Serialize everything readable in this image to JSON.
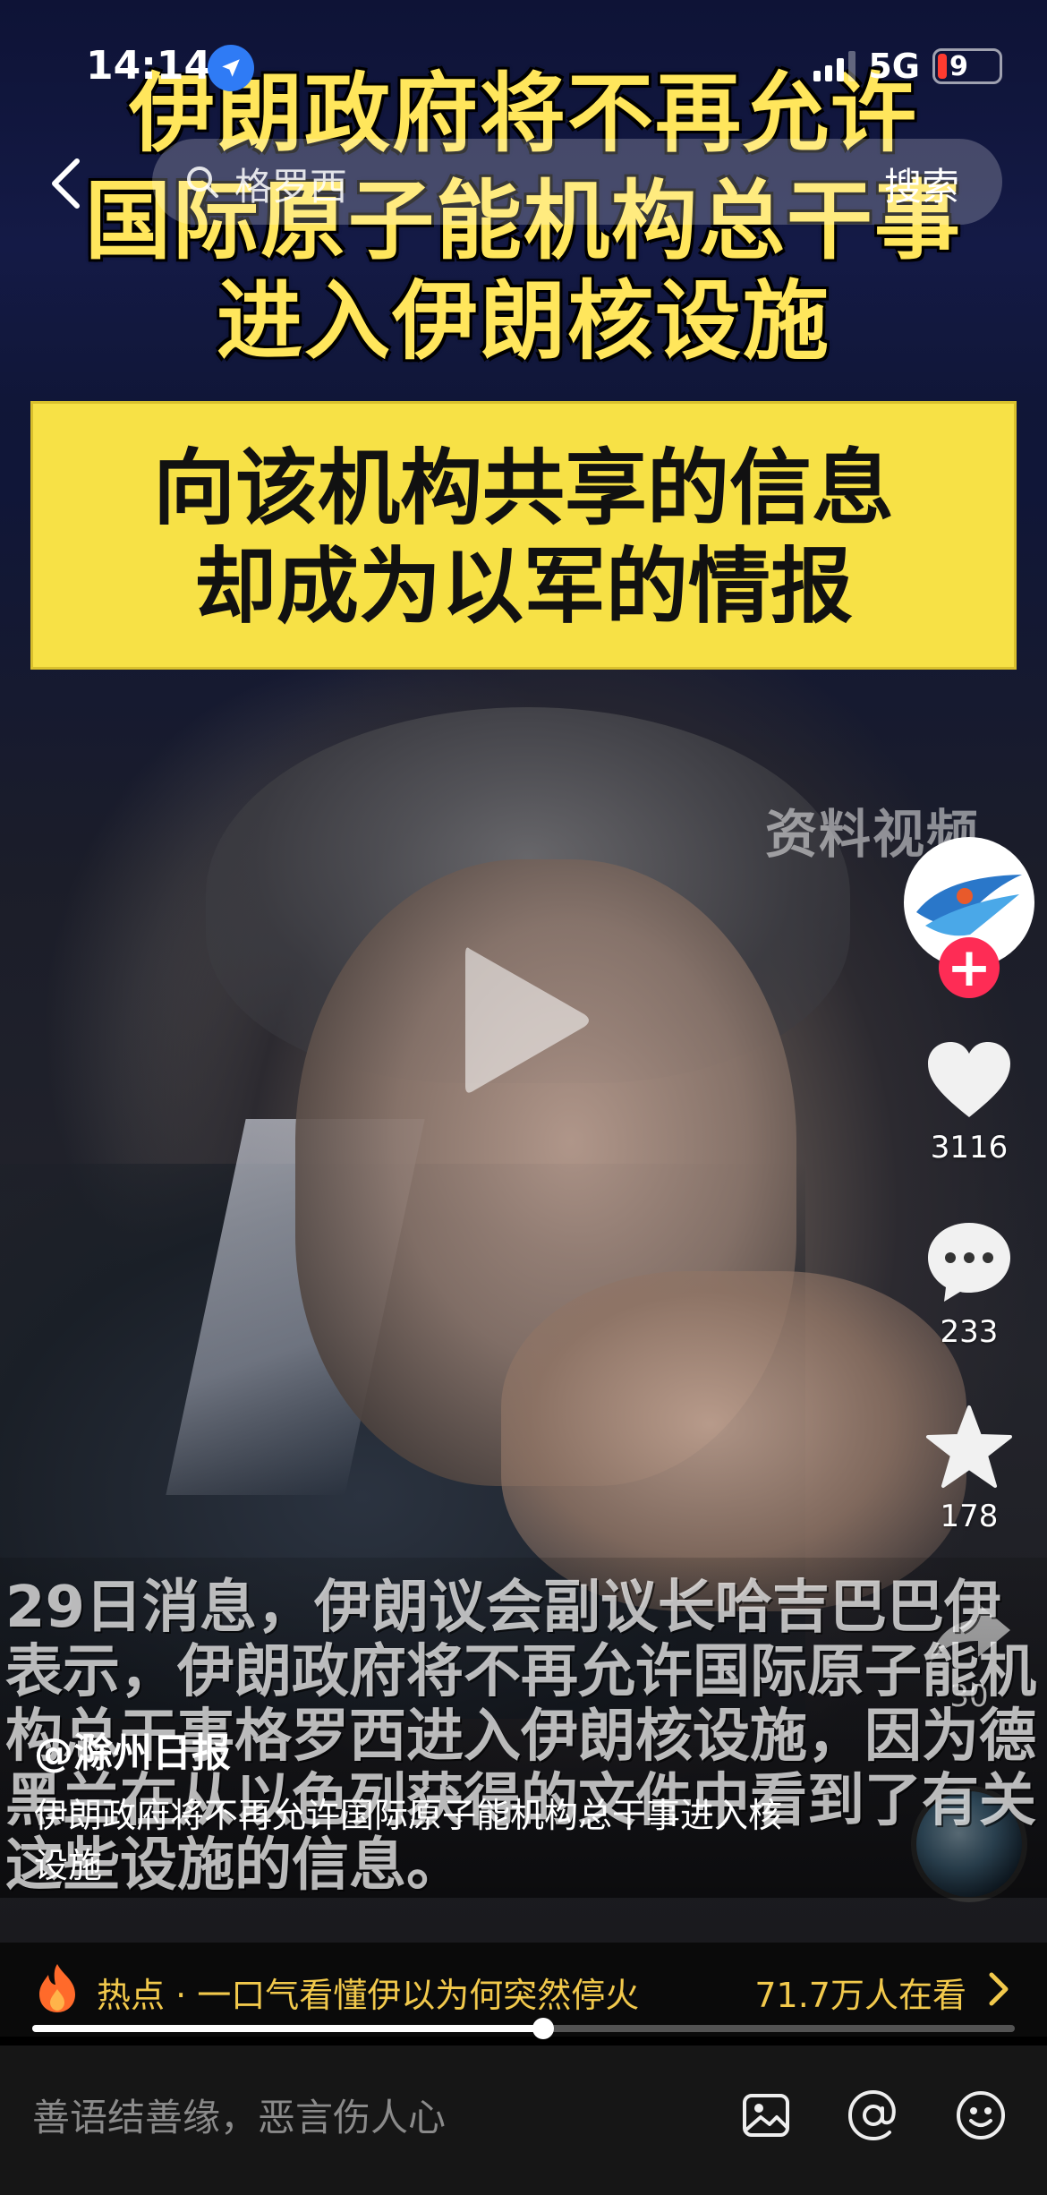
{
  "status_bar": {
    "time": "14:14",
    "network": "5G",
    "battery": "9"
  },
  "search": {
    "query": "格罗西",
    "button": "搜索"
  },
  "video": {
    "headline": [
      "伊朗政府将不再允许",
      "国际原子能机构总干事",
      "进入伊朗核设施"
    ],
    "subheadline": [
      "向该机构共享的信息",
      "却成为以军的情报"
    ],
    "watermark": "资料视频",
    "subtitle": "29日消息，伊朗议会副议长哈吉巴巴伊表示，伊朗政府将不再允许国际原子能机构总干事格罗西进入伊朗核设施，因为德黑兰在从以色列获得的文件中看到了有关这些设施的信息。",
    "progress": 0.52
  },
  "actions": {
    "likes": "3116",
    "comments": "233",
    "favorites": "178",
    "shares": "30"
  },
  "post": {
    "author": "@滁州日报",
    "caption": "伊朗政府将不再允许国际原子能机构总干事进入核设施"
  },
  "hot_topic": {
    "label": "热点 · 一口气看懂伊以为何突然停火",
    "viewers": "71.7万人在看"
  },
  "comment": {
    "placeholder": "善语结善缘，恶言伤人心"
  },
  "colors": {
    "headline_yellow": "#ffe65c",
    "box_yellow": "#f7e146",
    "follow_red": "#fe2c55",
    "hot_gold": "#f2c94c"
  }
}
